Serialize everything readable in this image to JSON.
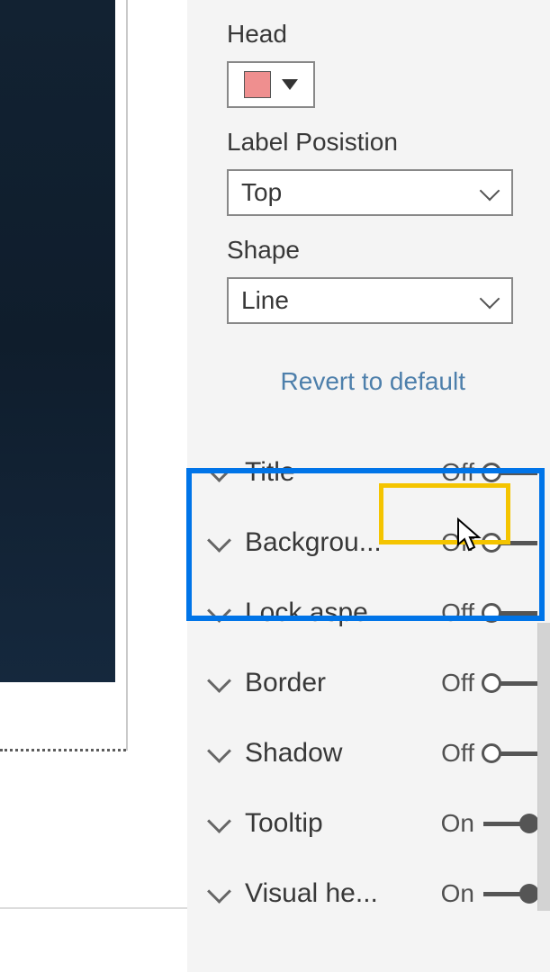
{
  "colors": {
    "head_swatch": "#ef8f8f",
    "blue_highlight": "#0074e8",
    "yellow_highlight": "#f4c400"
  },
  "section": {
    "head_label": "Head",
    "label_position": {
      "label": "Label Posistion",
      "value": "Top"
    },
    "shape": {
      "label": "Shape",
      "value": "Line"
    },
    "revert_label": "Revert to default"
  },
  "options": [
    {
      "label": "Title",
      "state": "Off",
      "on": false,
      "highlighted": true
    },
    {
      "label": "Backgrou...",
      "state": "Off",
      "on": false
    },
    {
      "label": "Lock aspe...",
      "state": "Off",
      "on": false
    },
    {
      "label": "Border",
      "state": "Off",
      "on": false
    },
    {
      "label": "Shadow",
      "state": "Off",
      "on": false
    },
    {
      "label": "Tooltip",
      "state": "On",
      "on": true
    },
    {
      "label": "Visual he...",
      "state": "On",
      "on": true
    }
  ]
}
